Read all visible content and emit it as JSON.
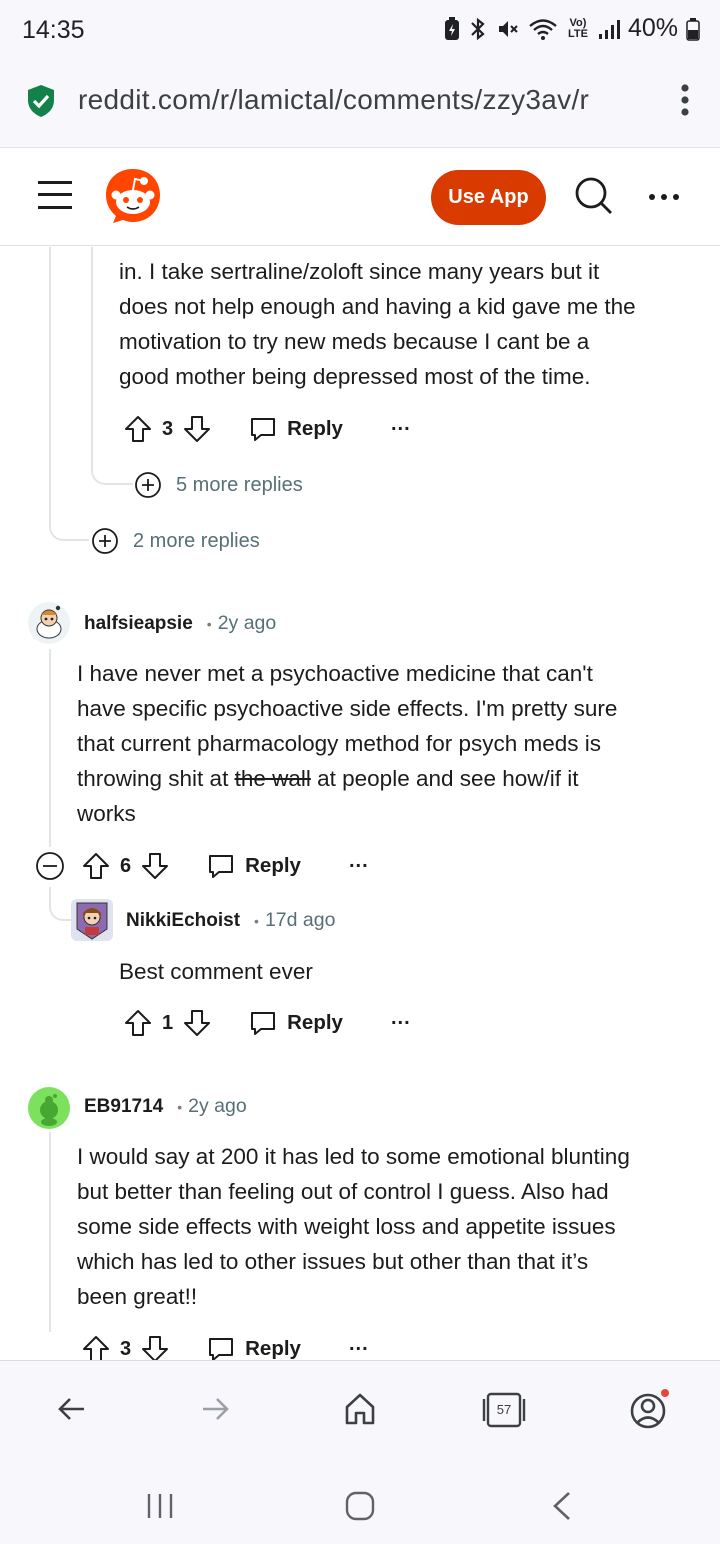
{
  "status_bar": {
    "time": "14:35",
    "battery": "40%",
    "network": "Vo) LTE"
  },
  "url_bar": {
    "url": "reddit.com/r/lamictal/comments/zzy3av/r"
  },
  "header": {
    "use_app_label": "Use App",
    "brand_color": "#d93a00"
  },
  "comments": {
    "partial": {
      "lines": [
        "in. I take sertraline/zoloft since many years but it",
        "does not help enough and having a kid gave me the",
        "motivation to try new meds because I cant be a",
        "good mother being depressed most of the time."
      ],
      "score": "3",
      "reply_label": "Reply",
      "more_replies": "5 more replies"
    },
    "parent_more_replies": "2 more replies",
    "halfsieapsie": {
      "author": "halfsieapsie",
      "age": "2y ago",
      "line1": "I have never met a psychoactive medicine that can't",
      "line2": "have specific psychoactive side effects. I'm pretty sure",
      "line3": "that current pharmacology method for psych meds is",
      "line4_before": "throwing shit at ",
      "line4_strike": "the wall",
      "line4_after": " at people and see how/if it",
      "line5": "works",
      "score": "6",
      "reply_label": "Reply"
    },
    "nikki": {
      "author": "NikkiEchoist",
      "age": "17d ago",
      "text": "Best comment ever",
      "score": "1",
      "reply_label": "Reply"
    },
    "eb": {
      "author": "EB91714",
      "age": "2y ago",
      "lines": [
        "I would say at 200 it has led to some emotional blunting",
        "but better than feeling out of control I guess. Also had",
        "some side effects with weight loss and appetite issues",
        "which has led to other issues but other than that it’s",
        "been great!!"
      ],
      "score": "3",
      "reply_label": "Reply"
    }
  },
  "bottom_nav": {
    "tab_count": "57"
  }
}
